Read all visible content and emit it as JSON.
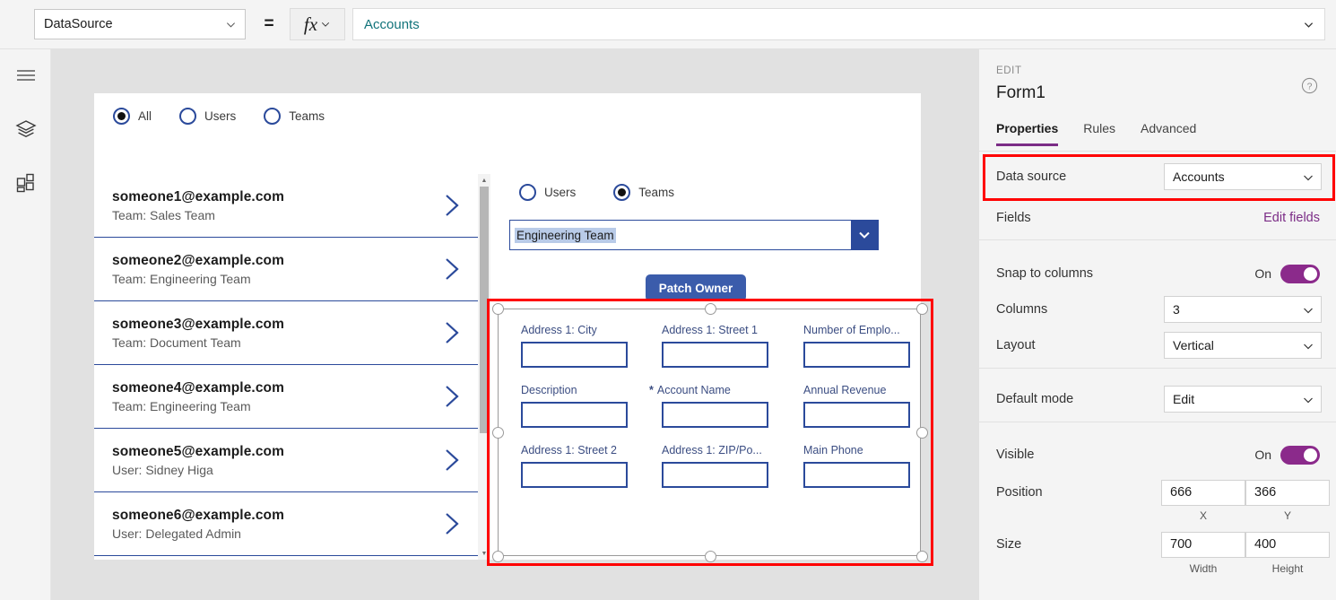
{
  "formula_bar": {
    "property": "DataSource",
    "equals": "=",
    "fx": "fx",
    "formula": "Accounts"
  },
  "rail": {
    "items": [
      {
        "icon": "hamburger-menu-icon"
      },
      {
        "icon": "layers-tree-icon"
      },
      {
        "icon": "components-grid-icon"
      }
    ]
  },
  "canvas": {
    "top_radio": {
      "options": [
        {
          "label": "All",
          "selected": true
        },
        {
          "label": "Users",
          "selected": false
        },
        {
          "label": "Teams",
          "selected": false
        }
      ]
    },
    "gallery": {
      "rows": [
        {
          "title": "someone1@example.com",
          "subtitle": "Team: Sales Team"
        },
        {
          "title": "someone2@example.com",
          "subtitle": "Team: Engineering Team"
        },
        {
          "title": "someone3@example.com",
          "subtitle": "Team: Document Team"
        },
        {
          "title": "someone4@example.com",
          "subtitle": "Team: Engineering Team"
        },
        {
          "title": "someone5@example.com",
          "subtitle": "User: Sidney Higa"
        },
        {
          "title": "someone6@example.com",
          "subtitle": "User: Delegated Admin"
        }
      ]
    },
    "detail_radio": {
      "options": [
        {
          "label": "Users",
          "selected": false
        },
        {
          "label": "Teams",
          "selected": true
        }
      ]
    },
    "dropdown": {
      "value": "Engineering Team"
    },
    "patch_button": {
      "label": "Patch Owner"
    },
    "form": {
      "fields": [
        {
          "label": "Address 1: City",
          "required": false,
          "value": ""
        },
        {
          "label": "Address 1: Street 1",
          "required": false,
          "value": ""
        },
        {
          "label": "Number of Emplo...",
          "required": false,
          "value": ""
        },
        {
          "label": "Description",
          "required": false,
          "value": ""
        },
        {
          "label": "Account Name",
          "required": true,
          "required_mark": "*",
          "value": ""
        },
        {
          "label": "Annual Revenue",
          "required": false,
          "value": ""
        },
        {
          "label": "Address 1: Street 2",
          "required": false,
          "value": ""
        },
        {
          "label": "Address 1: ZIP/Po...",
          "required": false,
          "value": ""
        },
        {
          "label": "Main Phone",
          "required": false,
          "value": ""
        }
      ]
    }
  },
  "panel": {
    "eyebrow": "EDIT",
    "title": "Form1",
    "tabs": [
      {
        "label": "Properties",
        "active": true
      },
      {
        "label": "Rules",
        "active": false
      },
      {
        "label": "Advanced",
        "active": false
      }
    ],
    "data_source": {
      "label": "Data source",
      "value": "Accounts"
    },
    "fields": {
      "label": "Fields",
      "link": "Edit fields"
    },
    "snap_to_columns": {
      "label": "Snap to columns",
      "state": "On"
    },
    "columns": {
      "label": "Columns",
      "value": "3"
    },
    "layout": {
      "label": "Layout",
      "value": "Vertical"
    },
    "default_mode": {
      "label": "Default mode",
      "value": "Edit"
    },
    "visible": {
      "label": "Visible",
      "state": "On"
    },
    "position": {
      "label": "Position",
      "x": "666",
      "y": "366",
      "x_caption": "X",
      "y_caption": "Y"
    },
    "size": {
      "label": "Size",
      "width": "700",
      "height": "400",
      "width_caption": "Width",
      "height_caption": "Height"
    }
  },
  "colors": {
    "accent_purple": "#8b2a8b",
    "link_purple": "#7b2c86",
    "formula_teal": "#11737a",
    "control_blue": "#2b4a9b",
    "button_blue": "#3b5cab",
    "annotation_red": "#ff0000"
  }
}
